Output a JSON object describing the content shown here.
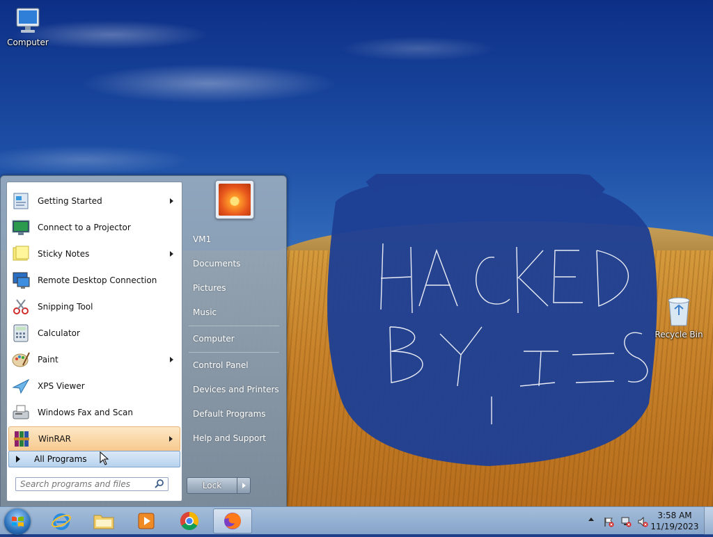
{
  "desktop": {
    "icons": [
      {
        "label": "Computer",
        "icon": "computer-icon"
      },
      {
        "label": "Recycle Bin",
        "icon": "recycle-bin-icon"
      }
    ],
    "wallpaper_scribble_text": "HACKED BY ISIS"
  },
  "start_menu": {
    "programs": [
      {
        "label": "Getting Started",
        "icon": "getting-started-icon",
        "has_submenu": true
      },
      {
        "label": "Connect to a Projector",
        "icon": "projector-icon",
        "has_submenu": false
      },
      {
        "label": "Sticky Notes",
        "icon": "sticky-notes-icon",
        "has_submenu": true
      },
      {
        "label": "Remote Desktop Connection",
        "icon": "remote-desktop-icon",
        "has_submenu": false
      },
      {
        "label": "Snipping Tool",
        "icon": "scissors-icon",
        "has_submenu": false
      },
      {
        "label": "Calculator",
        "icon": "calculator-icon",
        "has_submenu": false
      },
      {
        "label": "Paint",
        "icon": "paint-palette-icon",
        "has_submenu": true
      },
      {
        "label": "XPS Viewer",
        "icon": "xps-viewer-icon",
        "has_submenu": false
      },
      {
        "label": "Windows Fax and Scan",
        "icon": "fax-icon",
        "has_submenu": false
      },
      {
        "label": "WinRAR",
        "icon": "winrar-icon",
        "has_submenu": true,
        "highlighted": true
      }
    ],
    "all_programs_label": "All Programs",
    "search_placeholder": "Search programs and files",
    "right_items": [
      "VM1",
      "Documents",
      "Pictures",
      "Music",
      "Computer",
      "Control Panel",
      "Devices and Printers",
      "Default Programs",
      "Help and Support"
    ],
    "lock_label": "Lock"
  },
  "taskbar": {
    "pinned": [
      {
        "name": "internet-explorer",
        "icon": "internet-explorer-icon"
      },
      {
        "name": "windows-explorer",
        "icon": "folder-icon"
      },
      {
        "name": "media-player",
        "icon": "media-player-icon"
      },
      {
        "name": "chrome",
        "icon": "chrome-icon"
      },
      {
        "name": "firefox",
        "icon": "firefox-icon",
        "active": true
      }
    ],
    "clock": {
      "time": "3:58 AM",
      "date": "11/19/2023"
    }
  },
  "colors": {
    "highlight": "#f7c98e",
    "start_menu_bg": "#8a9cb0",
    "taskbar_bg": "#a9c3de",
    "scribble": "#1e3f94"
  }
}
